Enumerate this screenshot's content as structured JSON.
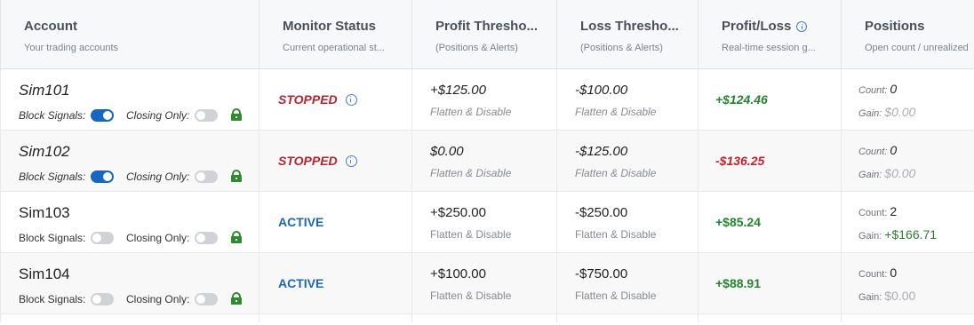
{
  "headers": [
    {
      "title": "Account",
      "sub": "Your trading accounts",
      "info": false
    },
    {
      "title": "Monitor Status",
      "sub": "Current operational st...",
      "info": false
    },
    {
      "title": "Profit Thresho...",
      "sub": "(Positions & Alerts)",
      "info": false
    },
    {
      "title": "Loss Thresho...",
      "sub": "(Positions & Alerts)",
      "info": false
    },
    {
      "title": "Profit/Loss",
      "sub": "Real-time session g...",
      "info": true
    },
    {
      "title": "Positions",
      "sub": "Open count / unrealized",
      "info": false
    }
  ],
  "labels": {
    "block_signals": "Block Signals:",
    "closing_only": "Closing Only:",
    "count": "Count:",
    "gain": "Gain:"
  },
  "rows": [
    {
      "account": "Sim101",
      "italic": true,
      "block_signals_on": true,
      "closing_only_on": false,
      "status": "STOPPED",
      "status_info": true,
      "profit": "+$125.00",
      "profit_sub": "Flatten & Disable",
      "loss": "-$100.00",
      "loss_sub": "Flatten & Disable",
      "pl": "+$124.46",
      "pl_sign": "pos",
      "count": "0",
      "gain": "$0.00",
      "gain_sign": "zero"
    },
    {
      "account": "Sim102",
      "italic": true,
      "block_signals_on": true,
      "closing_only_on": false,
      "status": "STOPPED",
      "status_info": true,
      "profit": "$0.00",
      "profit_sub": "Flatten & Disable",
      "loss": "-$125.00",
      "loss_sub": "Flatten & Disable",
      "pl": "-$136.25",
      "pl_sign": "neg",
      "count": "0",
      "gain": "$0.00",
      "gain_sign": "zero"
    },
    {
      "account": "Sim103",
      "italic": false,
      "block_signals_on": false,
      "closing_only_on": false,
      "status": "ACTIVE",
      "status_info": false,
      "profit": "+$250.00",
      "profit_sub": "Flatten & Disable",
      "loss": "-$250.00",
      "loss_sub": "Flatten & Disable",
      "pl": "+$85.24",
      "pl_sign": "pos",
      "count": "2",
      "gain": "+$166.71",
      "gain_sign": "pos"
    },
    {
      "account": "Sim104",
      "italic": false,
      "block_signals_on": false,
      "closing_only_on": false,
      "status": "ACTIVE",
      "status_info": false,
      "profit": "+$100.00",
      "profit_sub": "Flatten & Disable",
      "loss": "-$750.00",
      "loss_sub": "Flatten & Disable",
      "pl": "+$88.91",
      "pl_sign": "pos",
      "count": "0",
      "gain": "$0.00",
      "gain_sign": "zero"
    }
  ],
  "colors": {
    "stopped": "#b8232c",
    "active": "#1a67b8",
    "positive": "#22862d",
    "negative": "#c8202b",
    "toggle_on": "#1766c3",
    "lock": "#2e8b2e"
  }
}
